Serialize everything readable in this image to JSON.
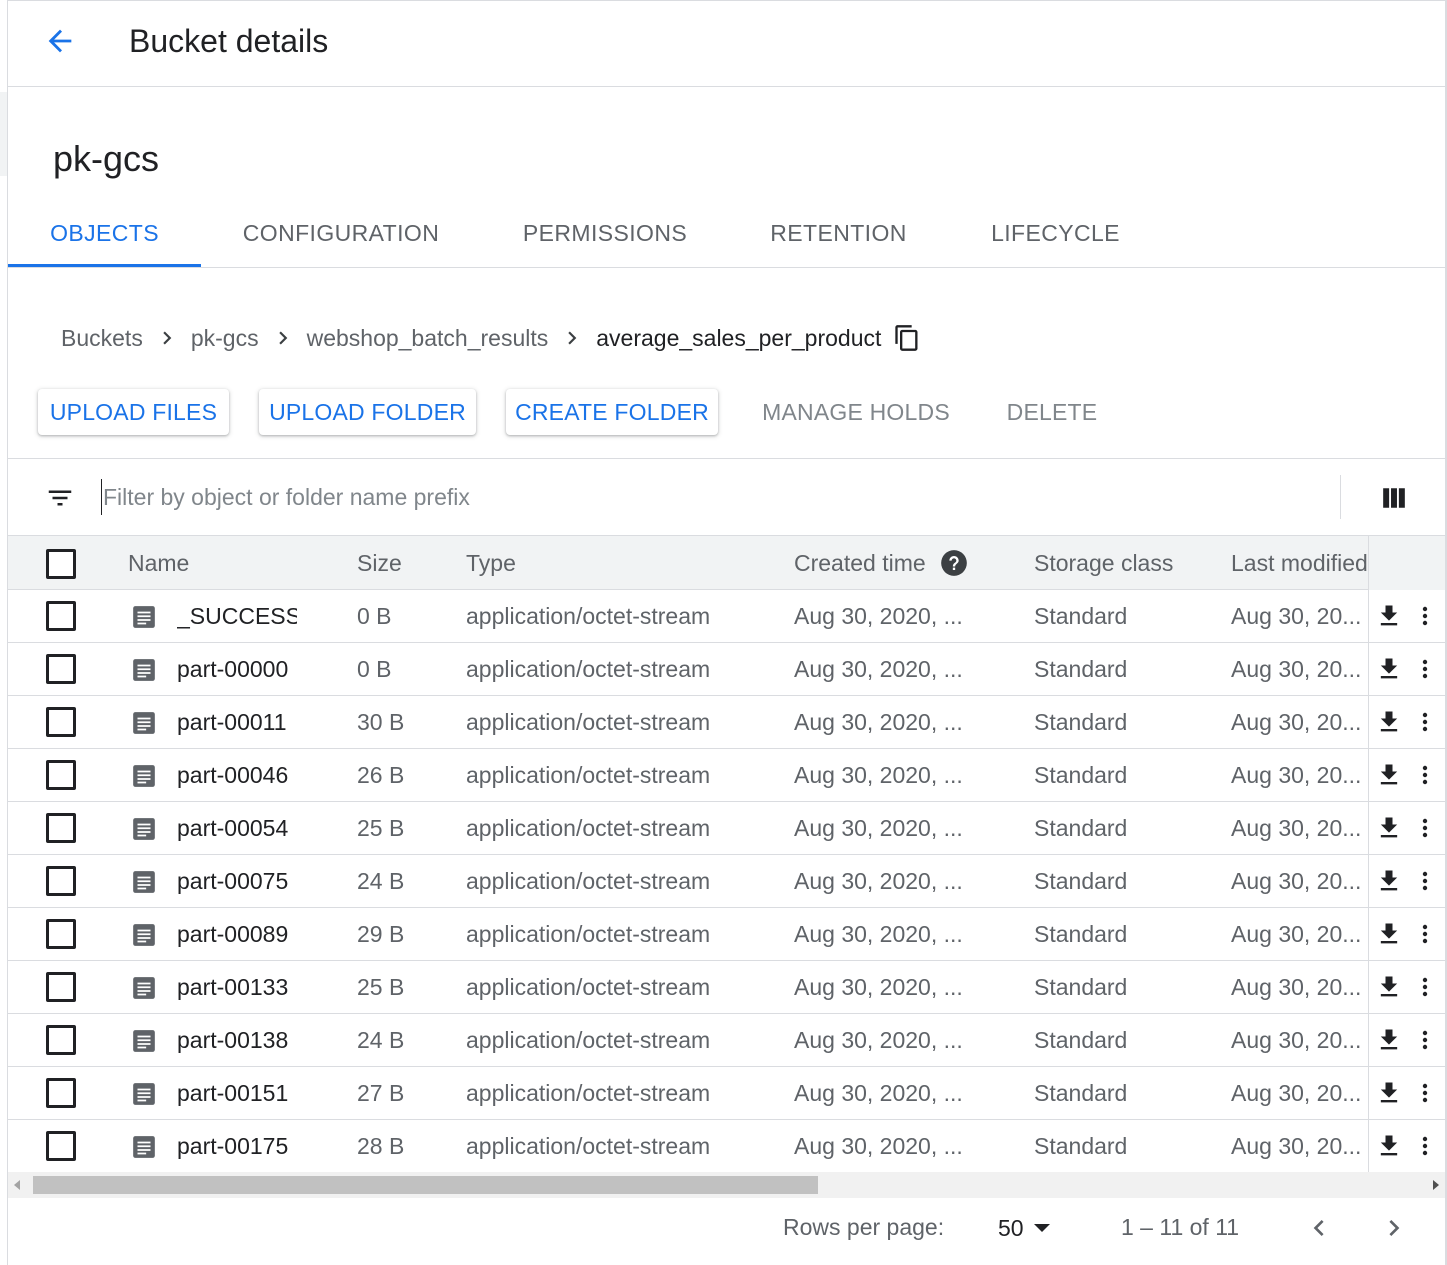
{
  "header": {
    "title": "Bucket details",
    "back_icon": "arrow-back-icon"
  },
  "bucket": {
    "name": "pk-gcs"
  },
  "tabs": [
    {
      "label": "OBJECTS",
      "active": true
    },
    {
      "label": "CONFIGURATION",
      "active": false
    },
    {
      "label": "PERMISSIONS",
      "active": false
    },
    {
      "label": "RETENTION",
      "active": false
    },
    {
      "label": "LIFECYCLE",
      "active": false
    }
  ],
  "breadcrumb": {
    "items": [
      "Buckets",
      "pk-gcs",
      "webshop_batch_results",
      "average_sales_per_product"
    ],
    "copy_icon": "copy-icon"
  },
  "actions": {
    "upload_files": "UPLOAD FILES",
    "upload_folder": "UPLOAD FOLDER",
    "create_folder": "CREATE FOLDER",
    "manage_holds": "MANAGE HOLDS",
    "delete": "DELETE"
  },
  "filter": {
    "placeholder": "Filter by object or folder name prefix",
    "value": ""
  },
  "table": {
    "columns": {
      "name": "Name",
      "size": "Size",
      "type": "Type",
      "created": "Created time",
      "storage_class": "Storage class",
      "last_modified": "Last modified"
    },
    "rows": [
      {
        "name": "_SUCCESS",
        "size": "0 B",
        "type": "application/octet-stream",
        "created": "Aug 30, 2020, ...",
        "storage_class": "Standard",
        "last_modified": "Aug 30, 20..."
      },
      {
        "name": "part-00000",
        "size": "0 B",
        "type": "application/octet-stream",
        "created": "Aug 30, 2020, ...",
        "storage_class": "Standard",
        "last_modified": "Aug 30, 20..."
      },
      {
        "name": "part-00011",
        "size": "30 B",
        "type": "application/octet-stream",
        "created": "Aug 30, 2020, ...",
        "storage_class": "Standard",
        "last_modified": "Aug 30, 20..."
      },
      {
        "name": "part-00046",
        "size": "26 B",
        "type": "application/octet-stream",
        "created": "Aug 30, 2020, ...",
        "storage_class": "Standard",
        "last_modified": "Aug 30, 20..."
      },
      {
        "name": "part-00054",
        "size": "25 B",
        "type": "application/octet-stream",
        "created": "Aug 30, 2020, ...",
        "storage_class": "Standard",
        "last_modified": "Aug 30, 20..."
      },
      {
        "name": "part-00075",
        "size": "24 B",
        "type": "application/octet-stream",
        "created": "Aug 30, 2020, ...",
        "storage_class": "Standard",
        "last_modified": "Aug 30, 20..."
      },
      {
        "name": "part-00089",
        "size": "29 B",
        "type": "application/octet-stream",
        "created": "Aug 30, 2020, ...",
        "storage_class": "Standard",
        "last_modified": "Aug 30, 20..."
      },
      {
        "name": "part-00133",
        "size": "25 B",
        "type": "application/octet-stream",
        "created": "Aug 30, 2020, ...",
        "storage_class": "Standard",
        "last_modified": "Aug 30, 20..."
      },
      {
        "name": "part-00138",
        "size": "24 B",
        "type": "application/octet-stream",
        "created": "Aug 30, 2020, ...",
        "storage_class": "Standard",
        "last_modified": "Aug 30, 20..."
      },
      {
        "name": "part-00151",
        "size": "27 B",
        "type": "application/octet-stream",
        "created": "Aug 30, 2020, ...",
        "storage_class": "Standard",
        "last_modified": "Aug 30, 20..."
      },
      {
        "name": "part-00175",
        "size": "28 B",
        "type": "application/octet-stream",
        "created": "Aug 30, 2020, ...",
        "storage_class": "Standard",
        "last_modified": "Aug 30, 20..."
      }
    ]
  },
  "pagination": {
    "rows_per_page_label": "Rows per page:",
    "rows_per_page": "50",
    "range": "1 – 11 of 11"
  },
  "colors": {
    "accent": "#1a73e8",
    "text": "#202124",
    "muted": "#5f6368",
    "divider": "#dadce0",
    "header_bg": "#f1f3f4"
  }
}
